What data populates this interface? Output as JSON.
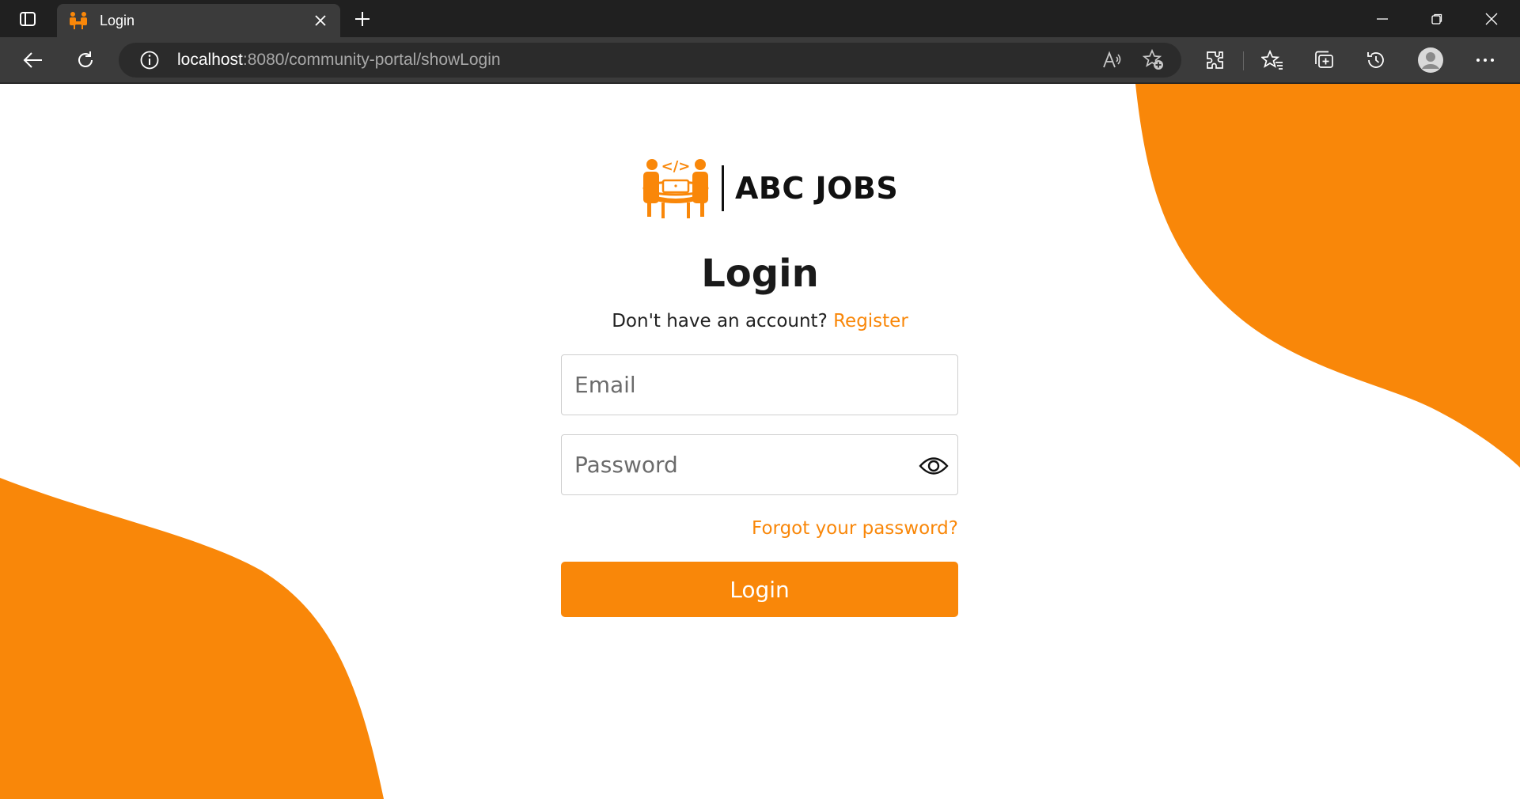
{
  "browser": {
    "tab": {
      "title": "Login"
    },
    "address": {
      "host": "localhost",
      "rest": ":8080/community-portal/showLogin"
    }
  },
  "page": {
    "logo_text": "ABC JOBS",
    "title": "Login",
    "register_prompt": "Don't have an account?",
    "register_link": "Register",
    "email_placeholder": "Email",
    "password_placeholder": "Password",
    "forgot_link": "Forgot your password?",
    "login_button": "Login"
  },
  "colors": {
    "accent": "#f98709",
    "chrome_dark": "#202020",
    "chrome_toolbar": "#3b3b3b",
    "text_dark": "#1a1a1a"
  },
  "icons": [
    "tab-actions-icon",
    "site-favicon",
    "close-icon",
    "plus-icon",
    "minimize-icon",
    "restore-icon",
    "window-close-icon",
    "back-arrow-icon",
    "refresh-icon",
    "info-icon",
    "read-aloud-icon",
    "add-favorite-icon",
    "extensions-icon",
    "favorites-icon",
    "collections-icon",
    "history-icon",
    "profile-avatar-icon",
    "more-options-icon",
    "eye-icon"
  ]
}
